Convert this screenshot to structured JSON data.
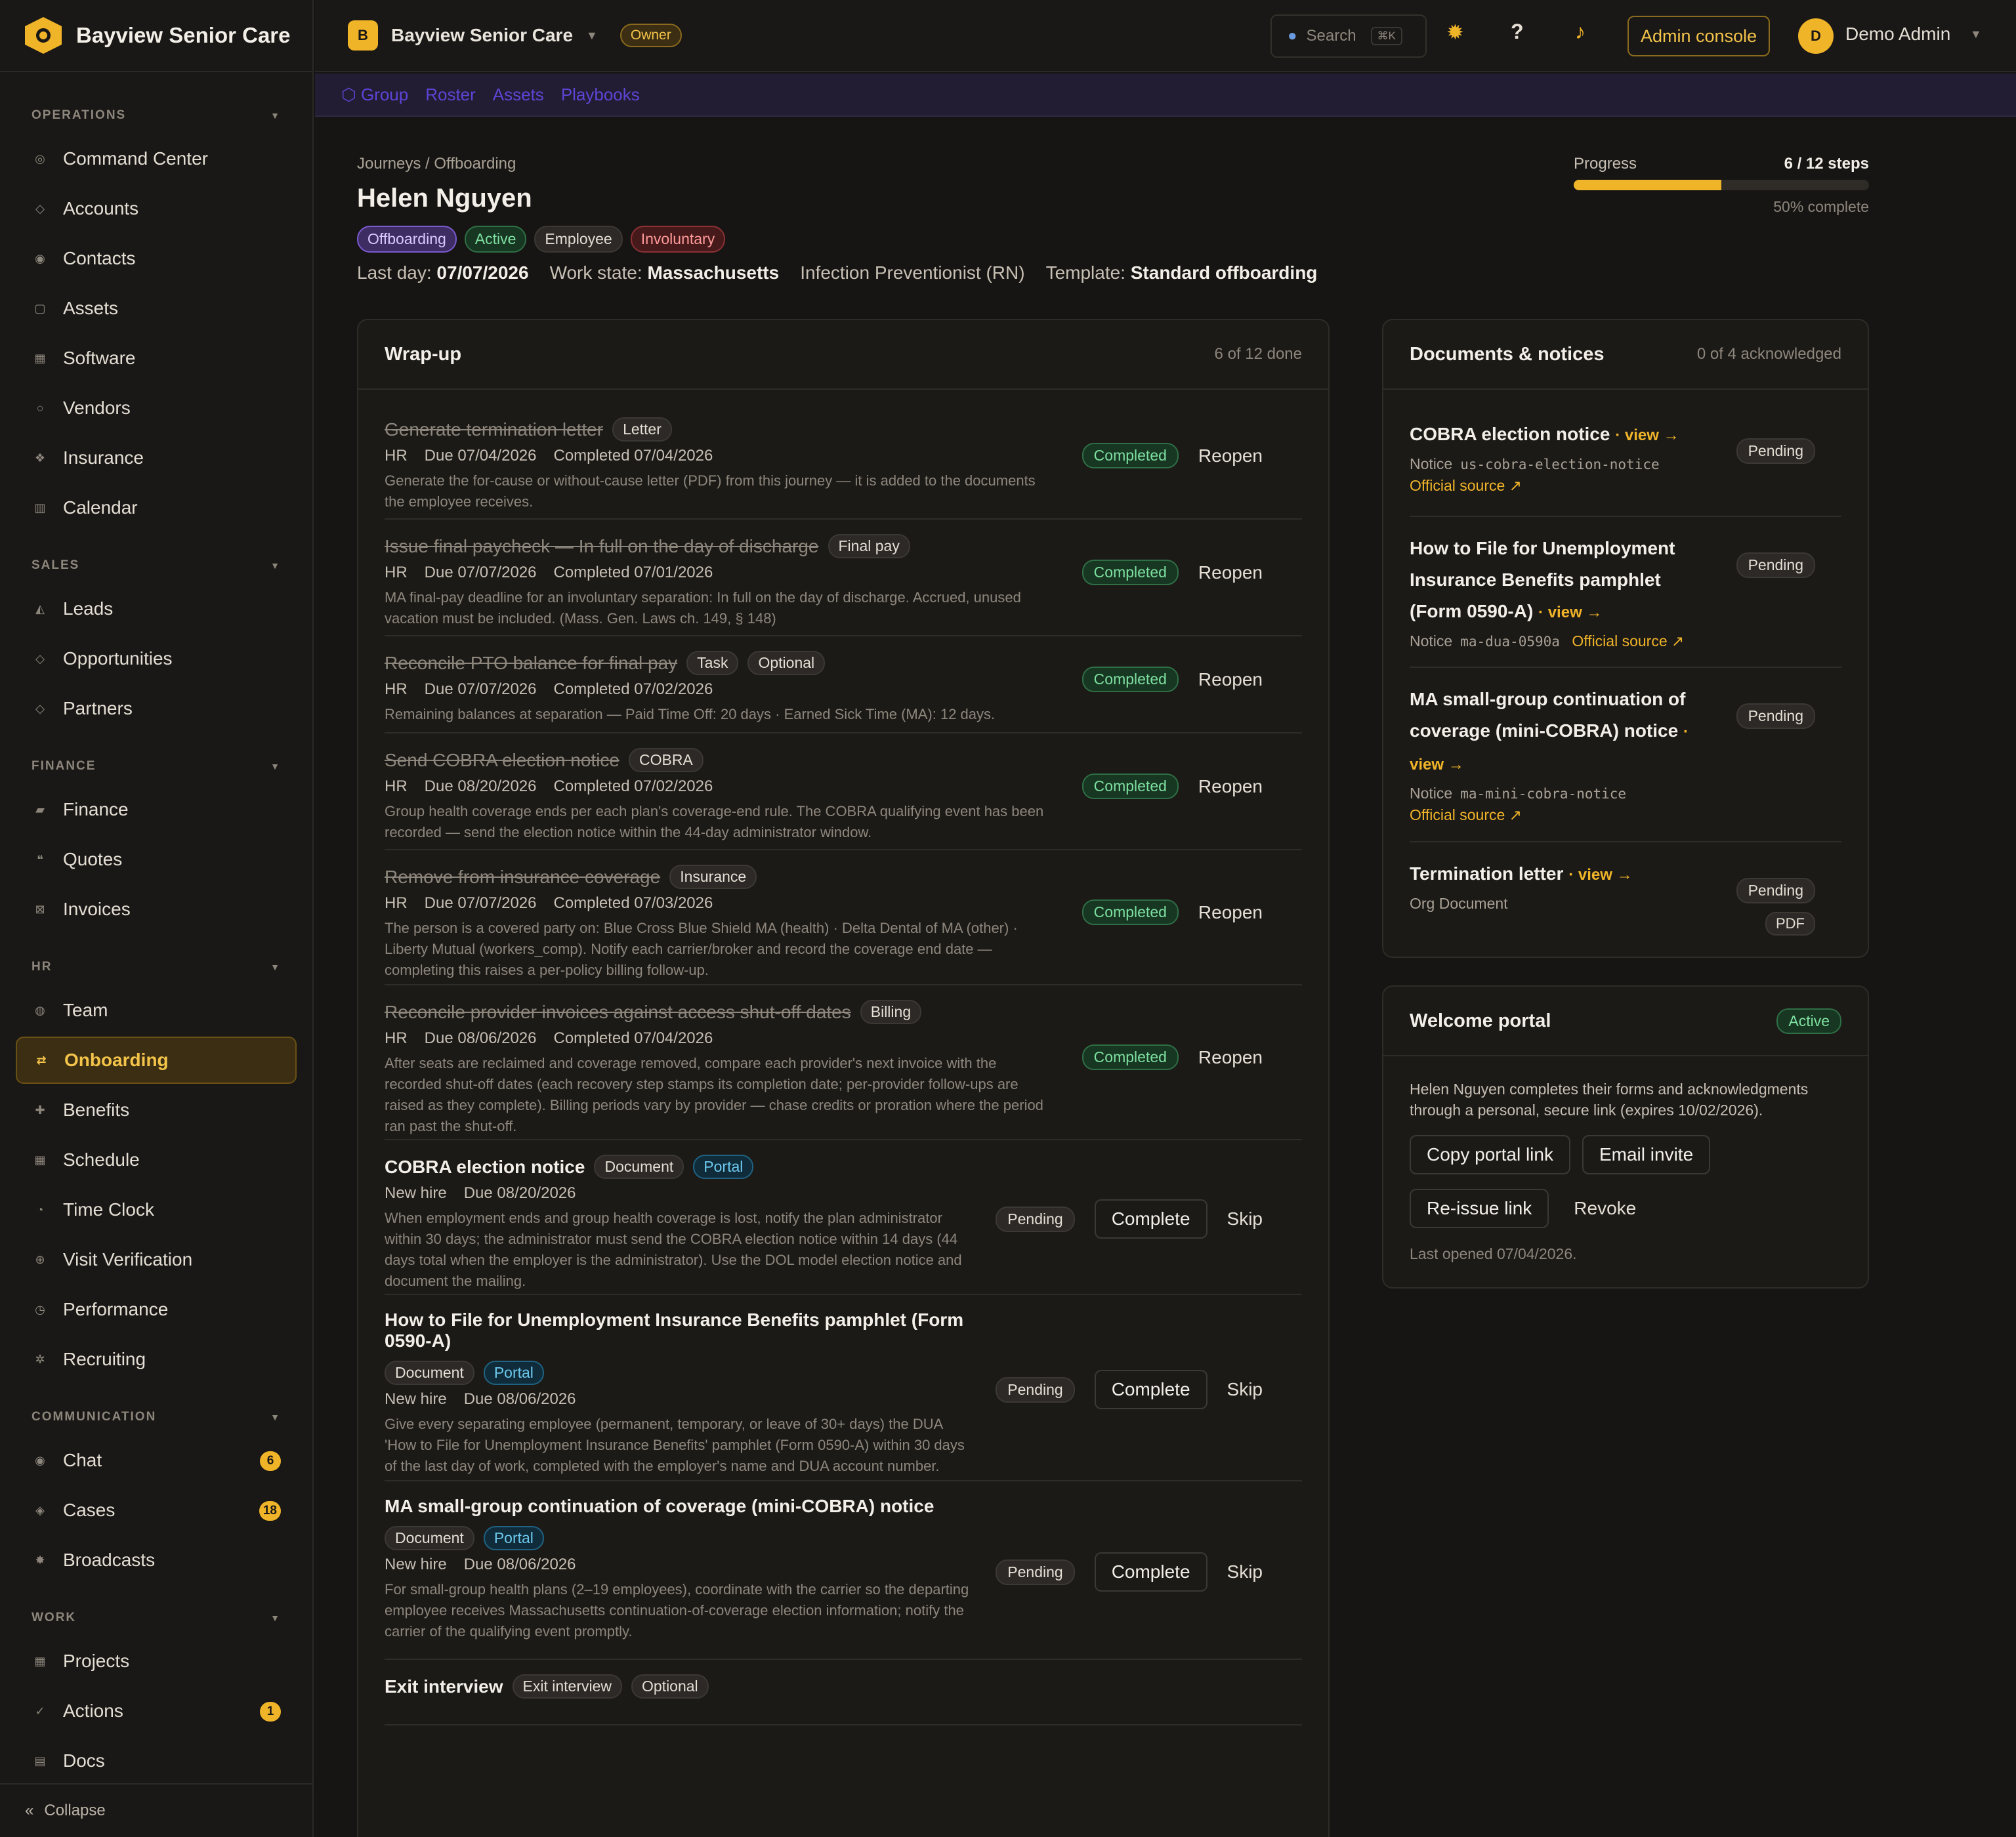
{
  "brand": {
    "name": "Bayview Senior Care"
  },
  "sidebar": {
    "sections": [
      {
        "title": "OPERATIONS",
        "items": [
          {
            "label": "Command Center",
            "icon": "target-icon"
          },
          {
            "label": "Accounts",
            "icon": "diamond-icon"
          },
          {
            "label": "Contacts",
            "icon": "person-icon"
          },
          {
            "label": "Assets",
            "icon": "box-icon"
          },
          {
            "label": "Software",
            "icon": "grid-icon"
          },
          {
            "label": "Vendors",
            "icon": "circle-icon"
          },
          {
            "label": "Insurance",
            "icon": "shield-icon"
          },
          {
            "label": "Calendar",
            "icon": "calendar-icon"
          }
        ]
      },
      {
        "title": "SALES",
        "items": [
          {
            "label": "Leads",
            "icon": "triangle-icon"
          },
          {
            "label": "Opportunities",
            "icon": "diamond-icon"
          },
          {
            "label": "Partners",
            "icon": "diamond-icon"
          }
        ]
      },
      {
        "title": "FINANCE",
        "items": [
          {
            "label": "Finance",
            "icon": "card-icon"
          },
          {
            "label": "Quotes",
            "icon": "quote-icon"
          },
          {
            "label": "Invoices",
            "icon": "receipt-icon"
          }
        ]
      },
      {
        "title": "HR",
        "items": [
          {
            "label": "Team",
            "icon": "people-icon"
          },
          {
            "label": "Onboarding",
            "icon": "swap-icon",
            "active": true
          },
          {
            "label": "Benefits",
            "icon": "plus-icon"
          },
          {
            "label": "Schedule",
            "icon": "grid-icon"
          },
          {
            "label": "Time Clock",
            "icon": "clock-icon"
          },
          {
            "label": "Visit Verification",
            "icon": "globe-icon"
          },
          {
            "label": "Performance",
            "icon": "gauge-icon"
          },
          {
            "label": "Recruiting",
            "icon": "gear-icon"
          }
        ]
      },
      {
        "title": "COMMUNICATION",
        "items": [
          {
            "label": "Chat",
            "icon": "chat-icon",
            "badge": "6"
          },
          {
            "label": "Cases",
            "icon": "case-icon",
            "badge": "18"
          },
          {
            "label": "Broadcasts",
            "icon": "broadcast-icon"
          }
        ]
      },
      {
        "title": "WORK",
        "items": [
          {
            "label": "Projects",
            "icon": "grid-icon"
          },
          {
            "label": "Actions",
            "icon": "check-icon",
            "badge": "1"
          },
          {
            "label": "Docs",
            "icon": "doc-icon"
          }
        ]
      }
    ],
    "collapse_label": "Collapse"
  },
  "topbar": {
    "org_initial": "B",
    "org_name": "Bayview Senior Care",
    "role": "Owner",
    "search_placeholder": "Search",
    "search_kbd": "⌘K",
    "admin_console": "Admin console",
    "user_initial": "D",
    "user_name": "Demo Admin"
  },
  "subnav": {
    "items": [
      "Group",
      "Roster",
      "Assets",
      "Playbooks"
    ]
  },
  "page": {
    "breadcrumb": "Journeys / Offboarding",
    "title": "Helen Nguyen",
    "chips": [
      "Offboarding",
      "Active",
      "Employee",
      "Involuntary"
    ],
    "meta": {
      "last_day_label": "Last day:",
      "last_day": "07/07/2026",
      "work_state_label": "Work state:",
      "work_state": "Massachusetts",
      "role": "Infection Preventionist (RN)",
      "template_label": "Template:",
      "template": "Standard offboarding"
    },
    "progress": {
      "label": "Progress",
      "steps": "6 / 12 steps",
      "percent_text": "50% complete",
      "fraction": 0.5
    }
  },
  "wrapup": {
    "title": "Wrap-up",
    "count": "6 of 12 done",
    "tasks": [
      {
        "title": "Generate termination letter",
        "tags": [
          "Letter"
        ],
        "owner": "HR",
        "due": "Due 07/04/2026",
        "completed": "Completed 07/04/2026",
        "desc": "Generate the for-cause or without-cause letter (PDF) from this journey — it is added to the documents the employee receives.",
        "status": "Completed",
        "action": "Reopen"
      },
      {
        "title": "Issue final paycheck — In full on the day of discharge",
        "tags": [
          "Final pay"
        ],
        "owner": "HR",
        "due": "Due 07/07/2026",
        "completed": "Completed 07/01/2026",
        "desc": "MA final-pay deadline for an involuntary separation: In full on the day of discharge. Accrued, unused vacation must be included. (Mass. Gen. Laws ch. 149, § 148)",
        "status": "Completed",
        "action": "Reopen"
      },
      {
        "title": "Reconcile PTO balance for final pay",
        "tags": [
          "Task",
          "Optional"
        ],
        "owner": "HR",
        "due": "Due 07/07/2026",
        "completed": "Completed 07/02/2026",
        "desc": "Remaining balances at separation — Paid Time Off: 20 days · Earned Sick Time (MA): 12 days.",
        "status": "Completed",
        "action": "Reopen"
      },
      {
        "title": "Send COBRA election notice",
        "tags": [
          "COBRA"
        ],
        "owner": "HR",
        "due": "Due 08/20/2026",
        "completed": "Completed 07/02/2026",
        "desc": "Group health coverage ends per each plan's coverage-end rule. The COBRA qualifying event has been recorded — send the election notice within the 44-day administrator window.",
        "status": "Completed",
        "action": "Reopen"
      },
      {
        "title": "Remove from insurance coverage",
        "tags": [
          "Insurance"
        ],
        "owner": "HR",
        "due": "Due 07/07/2026",
        "completed": "Completed 07/03/2026",
        "desc": "The person is a covered party on: Blue Cross Blue Shield MA (health) · Delta Dental of MA (other) · Liberty Mutual (workers_comp). Notify each carrier/broker and record the coverage end date — completing this raises a per-policy billing follow-up.",
        "status": "Completed",
        "action": "Reopen"
      },
      {
        "title": "Reconcile provider invoices against access shut-off dates",
        "tags": [
          "Billing"
        ],
        "owner": "HR",
        "due": "Due 08/06/2026",
        "completed": "Completed 07/04/2026",
        "desc": "After seats are reclaimed and coverage removed, compare each provider's next invoice with the recorded shut-off dates (each recovery step stamps its completion date; per-provider follow-ups are raised as they complete). Billing periods vary by provider — chase credits or proration where the period ran past the shut-off.",
        "status": "Completed",
        "action": "Reopen"
      },
      {
        "title": "COBRA election notice",
        "tags": [
          "Document",
          "Portal"
        ],
        "owner": "New hire",
        "due": "Due 08/20/2026",
        "desc": "When employment ends and group health coverage is lost, notify the plan administrator within 30 days; the administrator must send the COBRA election notice within 14 days (44 days total when the employer is the administrator). Use the DOL model election notice and document the mailing.",
        "status": "Pending",
        "action": "Complete",
        "action2": "Skip"
      },
      {
        "title": "How to File for Unemployment Insurance Benefits pamphlet (Form 0590-A)",
        "tags": [
          "Document",
          "Portal"
        ],
        "owner": "New hire",
        "due": "Due 08/06/2026",
        "desc": "Give every separating employee (permanent, temporary, or leave of 30+ days) the DUA 'How to File for Unemployment Insurance Benefits' pamphlet (Form 0590-A) within 30 days of the last day of work, completed with the employer's name and DUA account number.",
        "status": "Pending",
        "action": "Complete",
        "action2": "Skip"
      },
      {
        "title": "MA small-group continuation of coverage (mini-COBRA) notice",
        "tags": [
          "Document",
          "Portal"
        ],
        "owner": "New hire",
        "due": "Due 08/06/2026",
        "desc": "For small-group health plans (2–19 employees), coordinate with the carrier so the departing employee receives Massachusetts continuation-of-coverage election information; notify the carrier of the qualifying event promptly.",
        "status": "Pending",
        "action": "Complete",
        "action2": "Skip"
      },
      {
        "title": "Exit interview",
        "tags": [
          "Exit interview",
          "Optional"
        ]
      }
    ]
  },
  "documents": {
    "title": "Documents & notices",
    "count": "0 of 4 acknowledged",
    "items": [
      {
        "title": "COBRA election notice",
        "view": "· view →",
        "kind": "Notice",
        "code": "us-cobra-election-notice",
        "source": "Official source ↗",
        "status": "Pending"
      },
      {
        "title": "How to File for Unemployment Insurance Benefits pamphlet (Form 0590-A)",
        "view": "· view →",
        "kind": "Notice",
        "code": "ma-dua-0590a",
        "source": "Official source ↗",
        "status": "Pending"
      },
      {
        "title": "MA small-group continuation of coverage (mini-COBRA) notice",
        "view": "· view →",
        "kind": "Notice",
        "code": "ma-mini-cobra-notice",
        "source": "Official source ↗",
        "status": "Pending"
      },
      {
        "title": "Termination letter",
        "view": "· view →",
        "kind": "Org Document",
        "status": "Pending",
        "format": "PDF"
      }
    ]
  },
  "welcome": {
    "title": "Welcome portal",
    "status": "Active",
    "desc": "Helen Nguyen completes their forms and acknowledgments through a personal, secure link (expires 10/02/2026).",
    "copy_link": "Copy portal link",
    "email_invite": "Email invite",
    "reissue": "Re-issue link",
    "revoke": "Revoke",
    "last_opened": "Last opened 07/04/2026."
  },
  "colors": {
    "accent": "#f0b429",
    "bg": "#171513",
    "completed": "#7ee0a0",
    "portal": "#6cc8ee"
  }
}
